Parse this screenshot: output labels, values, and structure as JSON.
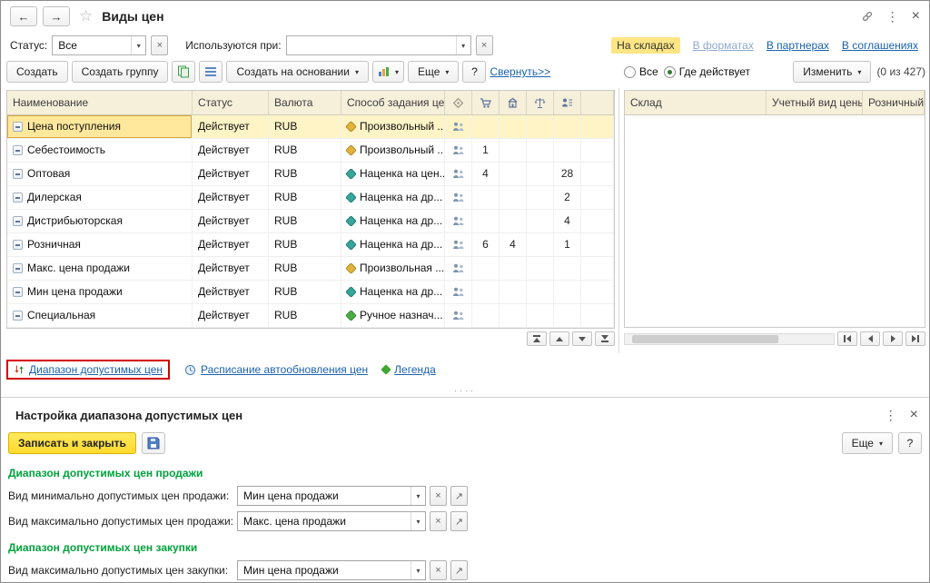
{
  "icons": {
    "back": "←",
    "forward": "→",
    "star": "☆",
    "dots": "⋮",
    "close": "×",
    "caret": "▾",
    "clear": "×",
    "open": "↗",
    "help": "?",
    "splitter_dots": "····"
  },
  "titlebar": {
    "title": "Виды цен"
  },
  "filters": {
    "status_label": "Статус:",
    "status_value": "Все",
    "usage_label": "Используются при:",
    "usage_value": "",
    "links": {
      "warehouses": "На складах",
      "formats": "В форматах",
      "partners": "В партнерах",
      "agreements": "В соглашениях"
    }
  },
  "toolbar": {
    "create": "Создать",
    "create_group": "Создать группу",
    "create_based_on": "Создать на основании",
    "more": "Еще",
    "collapse": "Свернуть>>"
  },
  "right_toolbar": {
    "radio_all": "Все",
    "radio_where": "Где действует",
    "edit": "Изменить",
    "count": "(0 из 427)"
  },
  "table": {
    "headers": {
      "name": "Наименование",
      "status": "Статус",
      "currency": "Валюта",
      "method": "Способ задания цены"
    },
    "rows": [
      {
        "name": "Цена поступления",
        "status": "Действует",
        "currency": "RUB",
        "method": "Произвольный ...",
        "method_type": "manual",
        "state": "selected"
      },
      {
        "name": "Себестоимость",
        "status": "Действует",
        "currency": "RUB",
        "method": "Произвольный ...",
        "method_type": "manual",
        "n1": "1"
      },
      {
        "name": "Оптовая",
        "status": "Действует",
        "currency": "RUB",
        "method": "Наценка на цен...",
        "method_type": "markup",
        "n1": "4",
        "n3": "28"
      },
      {
        "name": "Дилерская",
        "status": "Действует",
        "currency": "RUB",
        "method": "Наценка на др...",
        "method_type": "markup",
        "n3": "2"
      },
      {
        "name": "Дистрибьюторская",
        "status": "Действует",
        "currency": "RUB",
        "method": "Наценка на др...",
        "method_type": "markup",
        "n3": "4"
      },
      {
        "name": "Розничная",
        "status": "Действует",
        "currency": "RUB",
        "method": "Наценка на др...",
        "method_type": "markup",
        "n1": "6",
        "n2": "4",
        "n3": "1"
      },
      {
        "name": "Макс. цена продажи",
        "status": "Действует",
        "currency": "RUB",
        "method": "Произвольная ...",
        "method_type": "manual"
      },
      {
        "name": "Мин цена продажи",
        "status": "Действует",
        "currency": "RUB",
        "method": "Наценка на др...",
        "method_type": "markup"
      },
      {
        "name": "Специальная",
        "status": "Действует",
        "currency": "RUB",
        "method": "Ручное назнач...",
        "method_type": "hand"
      }
    ]
  },
  "right_table": {
    "headers": {
      "warehouse": "Склад",
      "accounting_price": "Учетный вид цены",
      "retail": "Розничный"
    }
  },
  "footer_links": {
    "range": "Диапазон допустимых цен",
    "schedule": "Расписание автообновления цен",
    "legend": "Легенда"
  },
  "dialog": {
    "title": "Настройка диапазона допустимых цен",
    "save_close": "Записать и закрыть",
    "more": "Еще",
    "section_sale": "Диапазон допустимых цен продажи",
    "section_purchase": "Диапазон допустимых цен закупки",
    "fields": [
      {
        "label": "Вид минимально допустимых цен продажи:",
        "value": "Мин цена продажи"
      },
      {
        "label": "Вид максимально допустимых цен продажи:",
        "value": "Макс. цена продажи"
      },
      {
        "label": "Вид максимально допустимых цен закупки:",
        "value": "Мин цена продажи"
      }
    ]
  },
  "colors": {
    "selected_row": "#fff4c6",
    "selected_cell": "#ffe89c",
    "active_link_bg": "#ffe584",
    "link_blue": "#1a62ae",
    "green_header": "#00a23c",
    "annotation_red": "#d40000",
    "primary_button": "#ffd92e",
    "table_header_bg": "#f6efda"
  }
}
